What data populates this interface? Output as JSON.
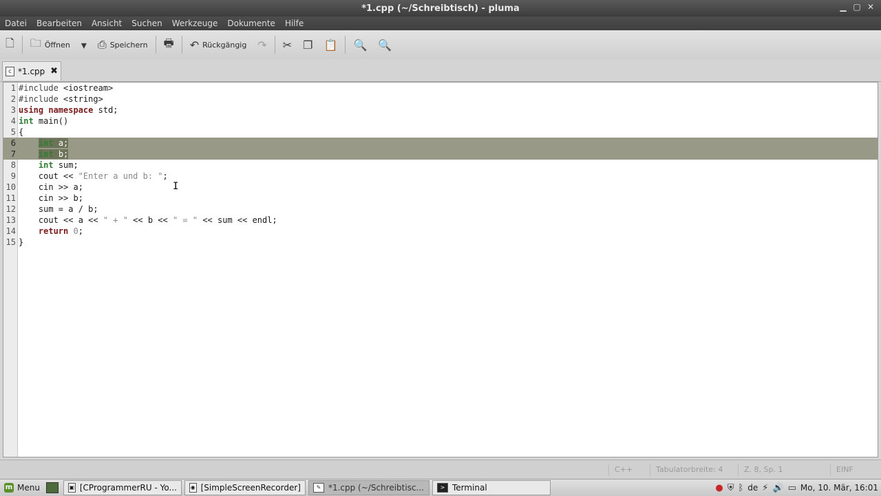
{
  "window": {
    "title": "*1.cpp (~/Schreibtisch) - pluma"
  },
  "menubar": [
    "Datei",
    "Bearbeiten",
    "Ansicht",
    "Suchen",
    "Werkzeuge",
    "Dokumente",
    "Hilfe"
  ],
  "toolbar": {
    "open_label": "Öffnen",
    "save_label": "Speichern",
    "undo_label": "Rückgängig"
  },
  "tab": {
    "label": "*1.cpp"
  },
  "editor": {
    "selected_lines": [
      6,
      7
    ],
    "lines": [
      {
        "num": "1",
        "text": "#include <iostream>"
      },
      {
        "num": "2",
        "text": "#include <string>"
      },
      {
        "num": "3",
        "text": "using namespace std;"
      },
      {
        "num": "4",
        "text": "int main()"
      },
      {
        "num": "5",
        "text": "{"
      },
      {
        "num": "6",
        "text": "    int a;"
      },
      {
        "num": "7",
        "text": "    int b;"
      },
      {
        "num": "8",
        "text": "    int sum;"
      },
      {
        "num": "9",
        "text": "    cout << \"Enter a und b: \";"
      },
      {
        "num": "10",
        "text": "    cin >> a;"
      },
      {
        "num": "11",
        "text": "    cin >> b;"
      },
      {
        "num": "12",
        "text": "    sum = a / b;"
      },
      {
        "num": "13",
        "text": "    cout << a << \" + \" << b << \" = \" << sum << endl;"
      },
      {
        "num": "14",
        "text": "    return 0;"
      },
      {
        "num": "15",
        "text": "}"
      }
    ]
  },
  "statusbar": [
    "C++",
    "Tabulatorbreite: 4",
    "Z. 8, Sp. 1",
    "EINF"
  ],
  "taskbar": {
    "menu_label": "Menu",
    "windows": [
      {
        "label": "[CProgrammerRU - Yo...",
        "active": false
      },
      {
        "label": "[SimpleScreenRecorder]",
        "active": false
      },
      {
        "label": "*1.cpp (~/Schreibtisc...",
        "active": true
      },
      {
        "label": "Terminal",
        "active": false
      }
    ],
    "keyboard_layout": "de",
    "clock": "Mo, 10. Mär, 16:01"
  }
}
